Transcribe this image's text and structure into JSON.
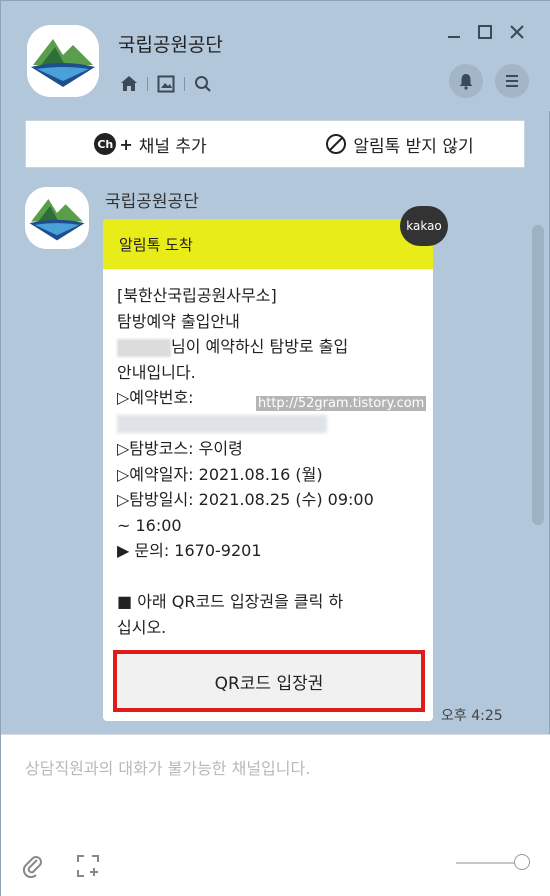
{
  "header": {
    "channel_name": "국립공원공단"
  },
  "action_bar": {
    "add_channel_badge": "Ch",
    "add_channel_plus": "+",
    "add_channel_label": "채널 추가",
    "block_label": "알림톡 받지 않기"
  },
  "message": {
    "sender": "국립공원공단",
    "badge": "kakao",
    "head": "알림톡 도착",
    "lines": [
      "[북한산국립공원사무소]",
      "탐방예약 출입안내",
      "님이 예약하신 탐방로 출입",
      "안내입니다.",
      "▷예약번호:",
      "▷탐방코스: 우이령",
      "▷예약일자: 2021.08.16 (월)",
      "▷탐방일시: 2021.08.25 (수) 09:00",
      "~ 16:00",
      "▶ 문의: 1670-9201",
      "■ 아래 QR코드 입장권을 클릭 하",
      "십시오."
    ],
    "watermark": "http://52gram.tistory.com",
    "button_label": "QR코드 입장권",
    "time": "오후 4:25"
  },
  "input": {
    "disabled_message": "상담직원과의 대화가 불가능한 채널입니다."
  },
  "colors": {
    "window_bg": "#b2c7da",
    "alert_header": "#e8ec18",
    "highlight_border": "#e01b1b"
  }
}
